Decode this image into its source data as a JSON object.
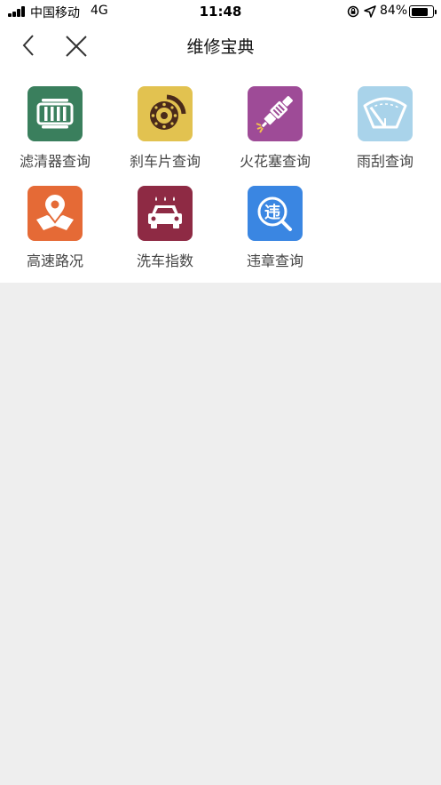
{
  "status_bar": {
    "carrier": "中国移动",
    "network": "4G",
    "time": "11:48",
    "battery_percent": "84%",
    "battery_level": 0.84
  },
  "nav": {
    "title": "维修宝典"
  },
  "grid": [
    {
      "label": "滤清器查询",
      "color": "#3a7f5d",
      "icon": "filter-icon"
    },
    {
      "label": "刹车片查询",
      "color": "#e2c250",
      "icon": "brake-disc-icon"
    },
    {
      "label": "火花塞查询",
      "color": "#9e4b97",
      "icon": "spark-plug-icon"
    },
    {
      "label": "雨刮查询",
      "color": "#a9d3ea",
      "icon": "wiper-icon"
    },
    {
      "label": "高速路况",
      "color": "#e56a36",
      "icon": "map-pin-icon"
    },
    {
      "label": "洗车指数",
      "color": "#8e2a44",
      "icon": "car-wash-icon"
    },
    {
      "label": "违章查询",
      "color": "#3a86e2",
      "icon": "violation-search-icon"
    }
  ],
  "icon_glyphs": {
    "violation": "违"
  }
}
